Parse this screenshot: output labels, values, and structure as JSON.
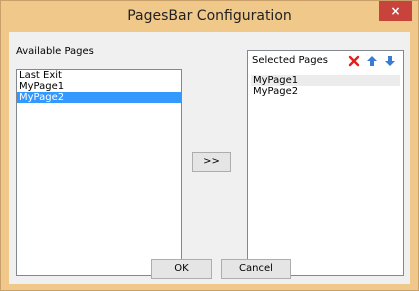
{
  "window": {
    "title": "PagesBar Configuration",
    "close_glyph": "×"
  },
  "available": {
    "label": "Available Pages",
    "items": [
      "Last Exit",
      "MyPage1",
      "MyPage2"
    ],
    "selected_index": 2
  },
  "transfer_button": {
    "label": ">>"
  },
  "selected": {
    "label": "Selected Pages",
    "items": [
      "MyPage1",
      "MyPage2"
    ],
    "icons": [
      "delete-icon",
      "move-up-icon",
      "move-down-icon"
    ]
  },
  "footer": {
    "ok_label": "OK",
    "cancel_label": "Cancel"
  },
  "colors": {
    "titlebar": "#f0c88a",
    "close": "#c7433b",
    "selection": "#3399ff",
    "delete": "#e0201c",
    "arrow": "#3a7bd5"
  }
}
